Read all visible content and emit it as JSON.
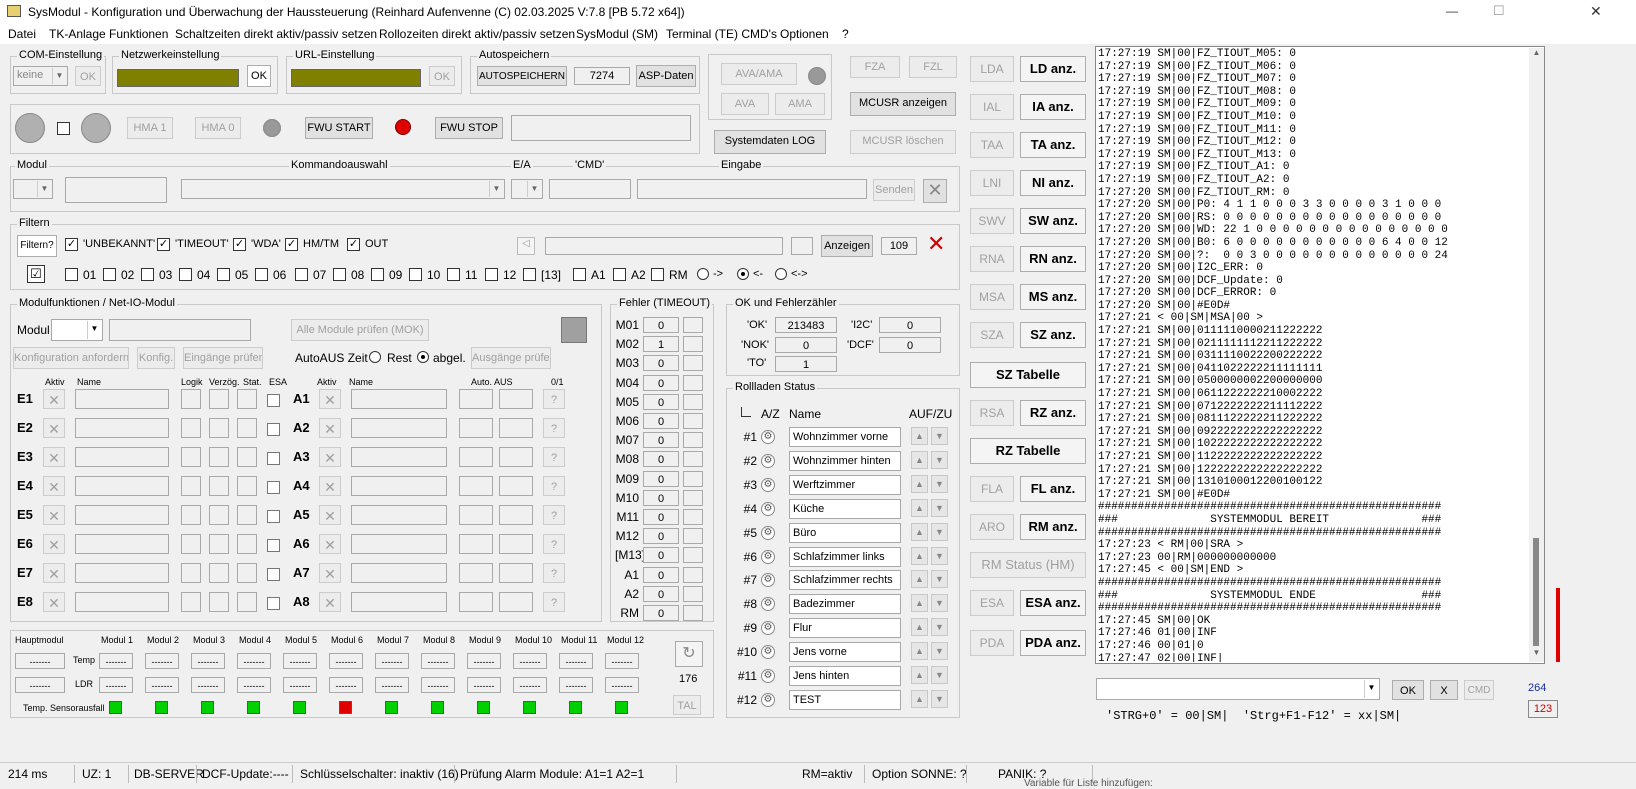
{
  "title": "SysModul - Konfiguration und Überwachung der Haussteuerung  (Reinhard Aufenvenne (C) 02.03.2025 V:7.8 [PB 5.72 x64])",
  "window": {
    "minimize": "—",
    "maximize": "☐",
    "close": "✕"
  },
  "menu": [
    "Datei",
    "TK-Anlage Funktionen",
    "Schaltzeiten direkt aktiv/passiv setzen",
    "Rollozeiten direkt aktiv/passiv setzen",
    "SysModul (SM)",
    "Terminal (TE) CMD's",
    "Optionen",
    "?"
  ],
  "com": {
    "label": "COM-Einstellung",
    "value": "keine",
    "ok": "OK"
  },
  "net": {
    "label": "Netzwerkeinstellung",
    "ok": "OK"
  },
  "url": {
    "label": "URL-Einstellung",
    "ok": "OK"
  },
  "auto": {
    "label": "Autospeichern",
    "button": "AUTOSPEICHERN",
    "value": "7274",
    "asp": "ASP-Daten"
  },
  "ava": {
    "ava_ama": "AVA/AMA",
    "ava": "AVA",
    "ama": "AMA"
  },
  "fz": {
    "fza": "FZA",
    "fzl": "FZL",
    "mcusr": "MCUSR anzeigen",
    "mcusr_del": "MCUSR löschen",
    "syslog": "Systemdaten LOG"
  },
  "hma": {
    "hma1": "HMA 1",
    "hma0": "HMA 0",
    "fwu_start": "FWU START",
    "fwu_stop": "FWU STOP"
  },
  "cmdrow": {
    "modul": "Modul",
    "kommando": "Kommandoauswahl",
    "ea": "E/A",
    "cmd": "'CMD'",
    "eingabe": "Eingabe",
    "senden": "Senden",
    "close": "✕"
  },
  "filter": {
    "label": "Filtern",
    "btn": "Filtern?",
    "checks": [
      "'UNBEKANNT'",
      "'TIMEOUT'",
      "'WDA'",
      "HM/TM",
      "OUT"
    ],
    "anzeigen": "Anzeigen",
    "count": "109",
    "close": "✕",
    "nums": [
      "01",
      "02",
      "03",
      "04",
      "05",
      "06",
      "07",
      "08",
      "09",
      "10",
      "11",
      "12",
      "[13]",
      "A1",
      "A2",
      "RM"
    ],
    "r1": "->",
    "r2": "<-",
    "r3": "<->"
  },
  "modul": {
    "label": "Modulfunktionen / Net-IO-Modul",
    "modul": "Modul",
    "pruefen": "Alle Module prüfen (MOK)",
    "konf": "Konfiguration anfordern",
    "konfig": "Konfig.",
    "eing": "Eingänge prüfen",
    "autoaus": "AutoAUS Zeit",
    "rest": "Rest",
    "abgel": "abgel.",
    "ausg": "Ausgänge prüfen",
    "hdr": {
      "aktiv": "Aktiv",
      "name": "Name",
      "logik": "Logik",
      "verz": "Verzög.",
      "stat": "Stat.",
      "esa": "ESA",
      "aktiv2": "Aktiv",
      "name2": "Name",
      "auto": "Auto. AUS",
      "z": "0/1"
    },
    "e": [
      "E1",
      "E2",
      "E3",
      "E4",
      "E5",
      "E6",
      "E7",
      "E8"
    ],
    "a": [
      "A1",
      "A2",
      "A3",
      "A4",
      "A5",
      "A6",
      "A7",
      "A8"
    ],
    "x": "✕",
    "q": "?"
  },
  "fehler": {
    "label": "Fehler (TIMEOUT)",
    "rows": [
      {
        "k": "M01",
        "v": "0"
      },
      {
        "k": "M02",
        "v": "1"
      },
      {
        "k": "M03",
        "v": "0"
      },
      {
        "k": "M04",
        "v": "0"
      },
      {
        "k": "M05",
        "v": "0"
      },
      {
        "k": "M06",
        "v": "0"
      },
      {
        "k": "M07",
        "v": "0"
      },
      {
        "k": "M08",
        "v": "0"
      },
      {
        "k": "M09",
        "v": "0"
      },
      {
        "k": "M10",
        "v": "0"
      },
      {
        "k": "M11",
        "v": "0"
      },
      {
        "k": "M12",
        "v": "0"
      },
      {
        "k": "[M13]",
        "v": "0"
      },
      {
        "k": "A1",
        "v": "0"
      },
      {
        "k": "A2",
        "v": "0"
      },
      {
        "k": "RM",
        "v": "0"
      }
    ]
  },
  "ok": {
    "label": "OK und Fehlerzähler",
    "ok_l": "'OK'",
    "ok_v": "213483",
    "nok_l": "'NOK'",
    "nok_v": "0",
    "to_l": "'TO'",
    "to_v": "1",
    "i2c_l": "'I2C'",
    "i2c_v": "0",
    "dcf_l": "'DCF'",
    "dcf_v": "0"
  },
  "roll": {
    "label": "Rollladen Status",
    "az": "A/Z",
    "name": "Name",
    "aufzu": "AUF/ZU",
    "items": [
      {
        "n": "#1",
        "name": "Wohnzimmer vorne"
      },
      {
        "n": "#2",
        "name": "Wohnzimmer hinten"
      },
      {
        "n": "#3",
        "name": "Werftzimmer"
      },
      {
        "n": "#4",
        "name": "Küche"
      },
      {
        "n": "#5",
        "name": "Büro"
      },
      {
        "n": "#6",
        "name": "Schlafzimmer links"
      },
      {
        "n": "#7",
        "name": "Schlafzimmer rechts"
      },
      {
        "n": "#8",
        "name": "Badezimmer"
      },
      {
        "n": "#9",
        "name": "Flur"
      },
      {
        "n": "#10",
        "name": "Jens vorne"
      },
      {
        "n": "#11",
        "name": "Jens hinten"
      },
      {
        "n": "#12",
        "name": "TEST"
      }
    ]
  },
  "temp": {
    "haupt": "Hauptmodul",
    "mods": [
      "Modul 1",
      "Modul 2",
      "Modul 3",
      "Modul 4",
      "Modul 5",
      "Modul 6",
      "Modul 7",
      "Modul 8",
      "Modul 9",
      "Modul 10",
      "Modul 11",
      "Modul 12"
    ],
    "dash": "-------",
    "temp": "Temp",
    "ldr": "LDR",
    "ausfall": "Temp. Sensorausfall",
    "count": "176",
    "tal": "TAL",
    "leds": [
      "green",
      "green",
      "green",
      "green",
      "green",
      "red",
      "green",
      "green",
      "green",
      "green",
      "green",
      "green"
    ]
  },
  "side": [
    {
      "l": "LDA",
      "r": "LD anz."
    },
    {
      "l": "IAL",
      "r": "IA anz."
    },
    {
      "l": "TAA",
      "r": "TA anz."
    },
    {
      "l": "LNI",
      "r": "NI anz."
    },
    {
      "l": "SWV",
      "r": "SW anz."
    },
    {
      "l": "RNA",
      "r": "RN anz."
    },
    {
      "l": "MSA",
      "r": "MS anz."
    },
    {
      "l": "SZA",
      "r": "SZ anz."
    }
  ],
  "side_sz": "SZ Tabelle",
  "side2": [
    {
      "l": "RSA",
      "r": "RZ anz."
    }
  ],
  "side_rz": "RZ Tabelle",
  "side3": [
    {
      "l": "FLA",
      "r": "FL anz."
    },
    {
      "l": "ARO",
      "r": "RM anz."
    }
  ],
  "rmstatus": "RM Status (HM)",
  "side4": [
    {
      "l": "ESA",
      "r": "ESA anz."
    },
    {
      "l": "PDA",
      "r": "PDA anz."
    }
  ],
  "log": [
    "17:27:19 SM|00|FZ_TIOUT_M05: 0",
    "17:27:19 SM|00|FZ_TIOUT_M06: 0",
    "17:27:19 SM|00|FZ_TIOUT_M07: 0",
    "17:27:19 SM|00|FZ_TIOUT_M08: 0",
    "17:27:19 SM|00|FZ_TIOUT_M09: 0",
    "17:27:19 SM|00|FZ_TIOUT_M10: 0",
    "17:27:19 SM|00|FZ_TIOUT_M11: 0",
    "17:27:19 SM|00|FZ_TIOUT_M12: 0",
    "17:27:19 SM|00|FZ_TIOUT_M13: 0",
    "17:27:19 SM|00|FZ_TIOUT_A1: 0",
    "17:27:19 SM|00|FZ_TIOUT_A2: 0",
    "17:27:20 SM|00|FZ_TIOUT_RM: 0",
    "17:27:20 SM|00|P0: 4 1 1 0 0 0 3 3 0 0 0 0 3 1 0 0 0",
    "17:27:20 SM|00|RS: 0 0 0 0 0 0 0 0 0 0 0 0 0 0 0 0 0",
    "17:27:20 SM|00|WD: 22 1 0 0 0 0 0 0 0 0 0 0 0 0 0 0 0",
    "17:27:20 SM|00|B0: 6 0 0 0 0 0 0 0 0 0 0 0 6 4 0 0 12",
    "17:27:20 SM|00|?:  0 0 3 0 0 0 0 0 0 0 0 0 0 0 0 0 24",
    "17:27:20 SM|00|I2C_ERR: 0",
    "17:27:20 SM|00|DCF_Update: 0",
    "17:27:20 SM|00|DCF_ERROR: 0",
    "17:27:20 SM|00|#E0D#",
    "17:27:21 < 00|SM|MSA|00 >",
    "17:27:21 SM|00|0111110000211222222",
    "17:27:21 SM|00|0211111112211222222",
    "17:27:21 SM|00|0311110022200222222",
    "17:27:21 SM|00|0411022222211111111",
    "17:27:21 SM|00|0500000002200000000",
    "17:27:21 SM|00|0611222222210002222",
    "17:27:21 SM|00|0712222222211112222",
    "17:27:21 SM|00|0811122222211222222",
    "17:27:21 SM|00|0922222222222222222",
    "17:27:21 SM|00|1022222222222222222",
    "17:27:21 SM|00|1122222222222222222",
    "17:27:21 SM|00|1222222222222222222",
    "17:27:21 SM|00|1310100012200100122",
    "17:27:21 SM|00|#E0D#",
    "####################################################",
    "###              SYSTEMMODUL BEREIT              ###",
    "####################################################",
    "17:27:23 < RM|00|SRA >",
    "17:27:23 00|RM|000000000000",
    "17:27:45 < 00|SM|END >",
    "####################################################",
    "###              SYSTEMMODUL ENDE                ###",
    "####################################################",
    "17:27:45 SM|00|OK",
    "17:27:46 01|00|INF",
    "17:27:46 00|01|0",
    "17:27:47 02|00|INF|"
  ],
  "cmdbar": {
    "ok": "OK",
    "x": "X",
    "cmd": "CMD",
    "n1": "264",
    "n2": "123",
    "hint": "'STRG+0' = 00|SM|  'Strg+F1-F12' = xx|SM|"
  },
  "status": [
    "214 ms",
    "UZ: 1",
    "DB-SERVER",
    "DCF-Update:----",
    "Schlüsselschalter: inaktiv (16)",
    "Prüfung Alarm Module: A1=1 A2=1",
    "RM=aktiv",
    "Option SONNE: ?",
    "PANIK: ?"
  ],
  "status_overflow": "Variable für Liste hinzufügen:"
}
